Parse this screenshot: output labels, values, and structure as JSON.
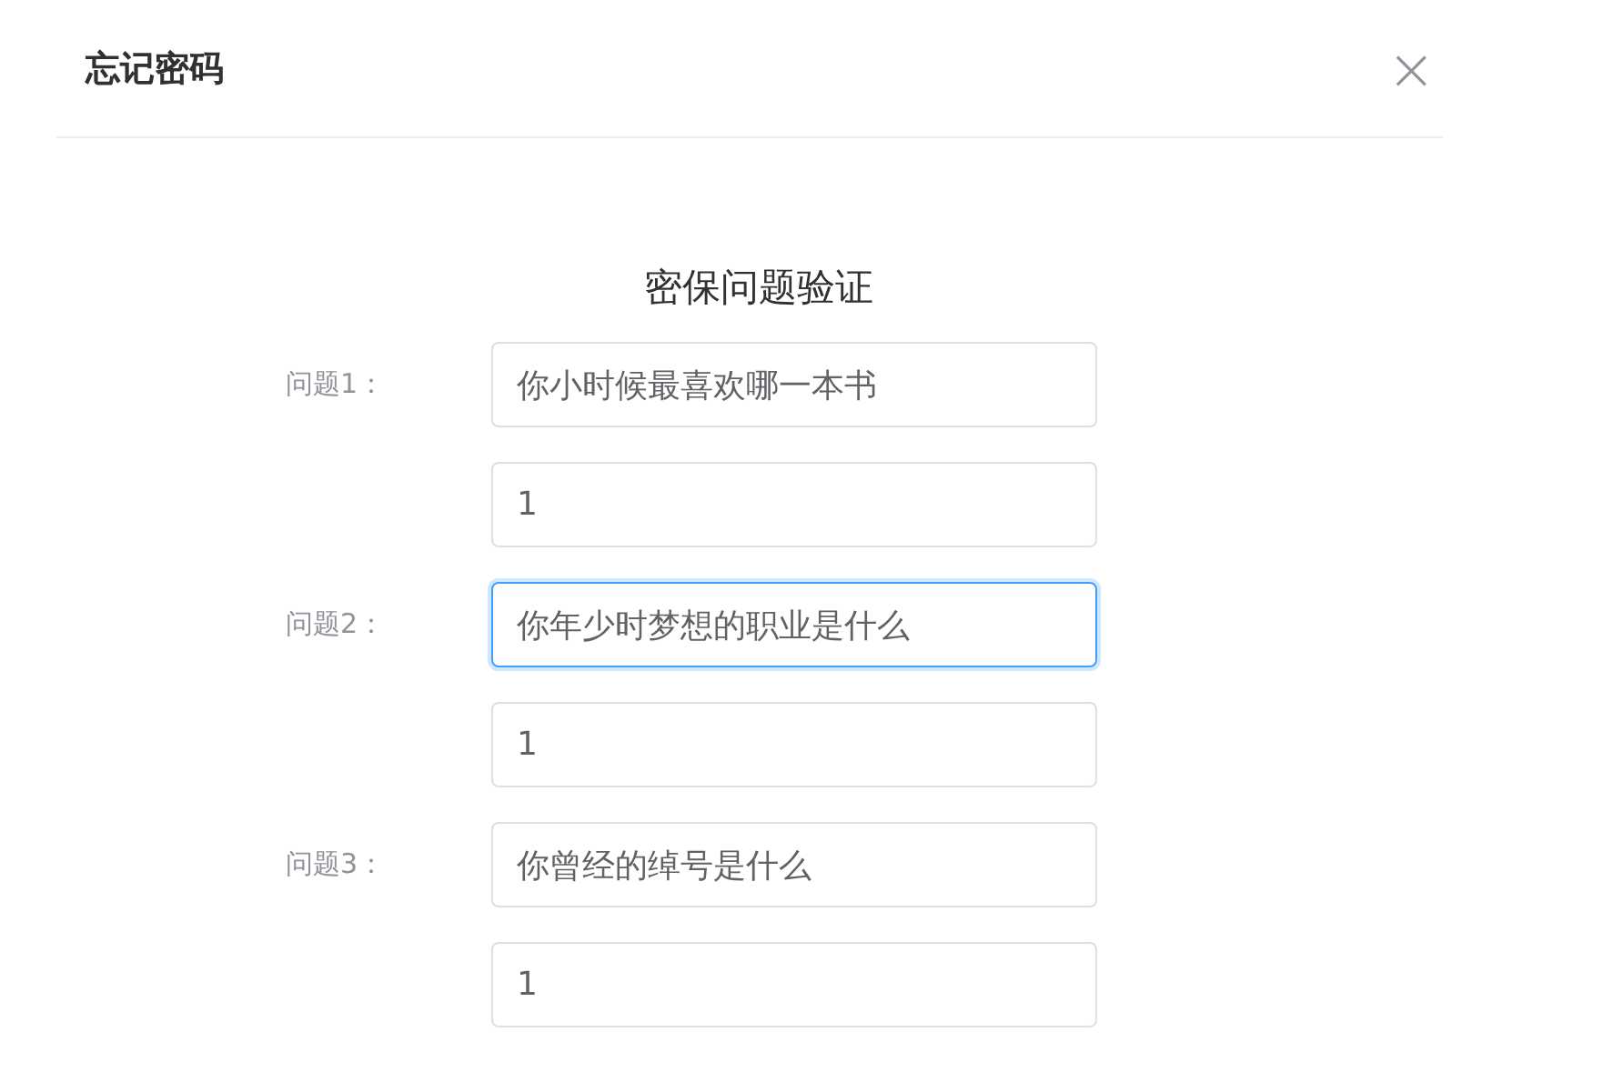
{
  "dialog": {
    "title": "忘记密码",
    "close": "×"
  },
  "form": {
    "heading": "密保问题验证",
    "rows": [
      {
        "label": "问题1：",
        "question": "你小时候最喜欢哪一本书",
        "answer": "1",
        "focused": false
      },
      {
        "label": "问题2：",
        "question": "你年少时梦想的职业是什么",
        "answer": "1",
        "focused": true
      },
      {
        "label": "问题3：",
        "question": "你曾经的绰号是什么",
        "answer": "1",
        "focused": false
      }
    ]
  }
}
